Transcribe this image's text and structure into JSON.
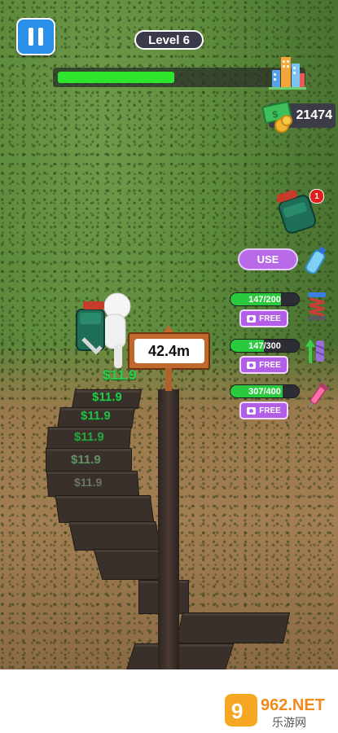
{
  "hud": {
    "level_label": "Level 6",
    "progress_fraction": 0.48,
    "money": "21474"
  },
  "inventory": {
    "backpack_badge": "1",
    "use_label": "USE"
  },
  "upgrades": [
    {
      "progress": "147/200",
      "fraction": 0.735,
      "button": "FREE",
      "icon": "spring-icon"
    },
    {
      "progress": "147/300",
      "fraction": 0.49,
      "button": "FREE",
      "icon": "drill-icon"
    },
    {
      "progress": "307/400",
      "fraction": 0.7675,
      "button": "FREE",
      "icon": "syringe-icon"
    }
  ],
  "depth_sign": "42.4m",
  "earnings": [
    "$11.9",
    "$11.9",
    "$11.9",
    "$11.9",
    "$11.9",
    "$11.9"
  ],
  "watermark": {
    "brand": "962.NET",
    "sub": "乐游网"
  },
  "colors": {
    "progress": "#2ee52e",
    "use_button": "#b86ae8",
    "earning_text": "#29d04a",
    "pause_button": "#2a8fe6"
  }
}
